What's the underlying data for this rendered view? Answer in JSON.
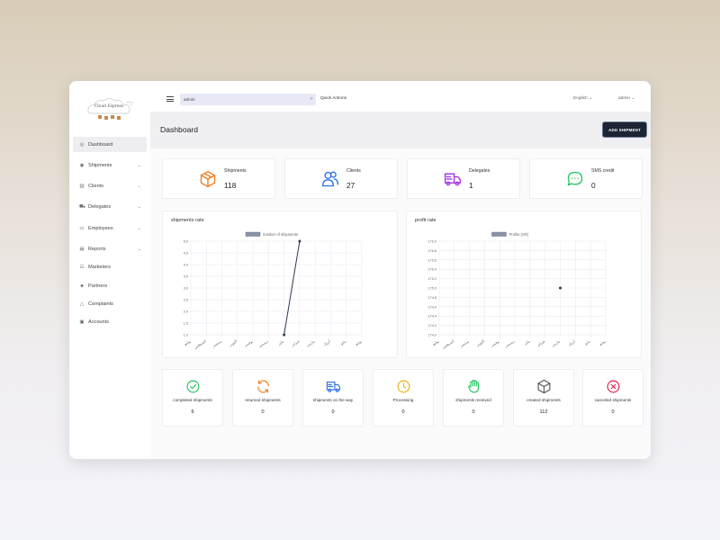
{
  "brand": {
    "name": "Cloud Express"
  },
  "sidebar": {
    "items": [
      {
        "label": "Dashboard",
        "icon": "gauge-icon",
        "glyph": "◎",
        "chevron": false,
        "active": true
      },
      {
        "label": "Shipments",
        "icon": "box-icon",
        "glyph": "◉",
        "chevron": true
      },
      {
        "label": "Clients",
        "icon": "clients-icon",
        "glyph": "▥",
        "chevron": true
      },
      {
        "label": "Delegates",
        "icon": "truck-icon",
        "glyph": "⛟",
        "chevron": true
      },
      {
        "label": "Employees",
        "icon": "employees-icon",
        "glyph": "▭",
        "chevron": true
      },
      {
        "label": "Reports",
        "icon": "folder-icon",
        "glyph": "▤",
        "chevron": true
      },
      {
        "label": "Marketers",
        "icon": "marketers-icon",
        "glyph": "☷",
        "chevron": false
      },
      {
        "label": "Partners",
        "icon": "partners-icon",
        "glyph": "♣",
        "chevron": false
      },
      {
        "label": "Complaints",
        "icon": "alert-icon",
        "glyph": "△",
        "chevron": false
      },
      {
        "label": "Accounts",
        "icon": "accounts-icon",
        "glyph": "▣",
        "chevron": false
      }
    ],
    "chevron_glyph": "⌄"
  },
  "topbar": {
    "search_value": "admin",
    "search_glyph": "⌕",
    "quick_actions": "Quick Actions",
    "language": "English ⌄",
    "user": "admin ⌄"
  },
  "page": {
    "title": "Dashboard",
    "add_button": "ADD SHIPMENT"
  },
  "stats": [
    {
      "label": "Shipments",
      "value": "118",
      "icon": "box-icon",
      "color": "#f07a1a"
    },
    {
      "label": "Clients",
      "value": "27",
      "icon": "users-icon",
      "color": "#2a72e8"
    },
    {
      "label": "Delegates",
      "value": "1",
      "icon": "truck-icon",
      "color": "#a12de0"
    },
    {
      "label": "SMS credit",
      "value": "0",
      "icon": "chat-icon",
      "color": "#22c55e"
    }
  ],
  "cards": [
    {
      "label": "completed shipments",
      "value": "6",
      "icon": "check-circle-icon",
      "color": "#22c55e"
    },
    {
      "label": "returned shipments",
      "value": "0",
      "icon": "refresh-icon",
      "color": "#f07a1a"
    },
    {
      "label": "shipments on the way",
      "value": "0",
      "icon": "truck-icon",
      "color": "#2a72e8"
    },
    {
      "label": "Processing",
      "value": "0",
      "icon": "clock-icon",
      "color": "#eab308"
    },
    {
      "label": "shipments received",
      "value": "0",
      "icon": "hand-icon",
      "color": "#22c55e"
    },
    {
      "label": "created shipments",
      "value": "112",
      "icon": "cube-icon",
      "color": "#555555"
    },
    {
      "label": "canceled shipments",
      "value": "0",
      "icon": "x-circle-icon",
      "color": "#e11d48"
    }
  ],
  "chart_data": [
    {
      "type": "line",
      "title": "shipments rate",
      "legend": "number of shipments",
      "legend_position": "top",
      "grid": true,
      "x": [
        "يوليو",
        "أغسطس",
        "سبتمبر",
        "أكتوبر",
        "نوفمبر",
        "ديسمبر",
        "يناير",
        "فبراير",
        "مارس",
        "أبريل",
        "مايو",
        "يونيو"
      ],
      "series": [
        {
          "name": "number of shipments",
          "values": [
            null,
            null,
            null,
            null,
            null,
            null,
            1,
            5,
            null,
            null,
            null,
            null
          ]
        }
      ],
      "yticks": [
        "1.0",
        "1.5",
        "2.0",
        "2.5",
        "3.0",
        "3.5",
        "4.0",
        "4.5",
        "5.0"
      ],
      "ylim": [
        1,
        5
      ],
      "line_color": "#2f3a52"
    },
    {
      "type": "scatter",
      "title": "profit rate",
      "legend": "Profits (SR)",
      "legend_position": "top",
      "grid": true,
      "x": [
        "يوليو",
        "أغسطس",
        "سبتمبر",
        "أكتوبر",
        "نوفمبر",
        "ديسمبر",
        "يناير",
        "فبراير",
        "مارس",
        "أبريل",
        "مايو",
        "يونيو"
      ],
      "series": [
        {
          "name": "Profits (SR)",
          "values": [
            null,
            null,
            null,
            null,
            null,
            null,
            null,
            null,
            175.0,
            null,
            null,
            null
          ]
        }
      ],
      "yticks": [
        "174.0",
        "174.2",
        "174.4",
        "174.6",
        "174.8",
        "175.0",
        "175.2",
        "175.4",
        "175.6",
        "175.8",
        "176.0"
      ],
      "ylim": [
        174.0,
        176.0
      ],
      "line_color": "#2f3a52"
    }
  ]
}
